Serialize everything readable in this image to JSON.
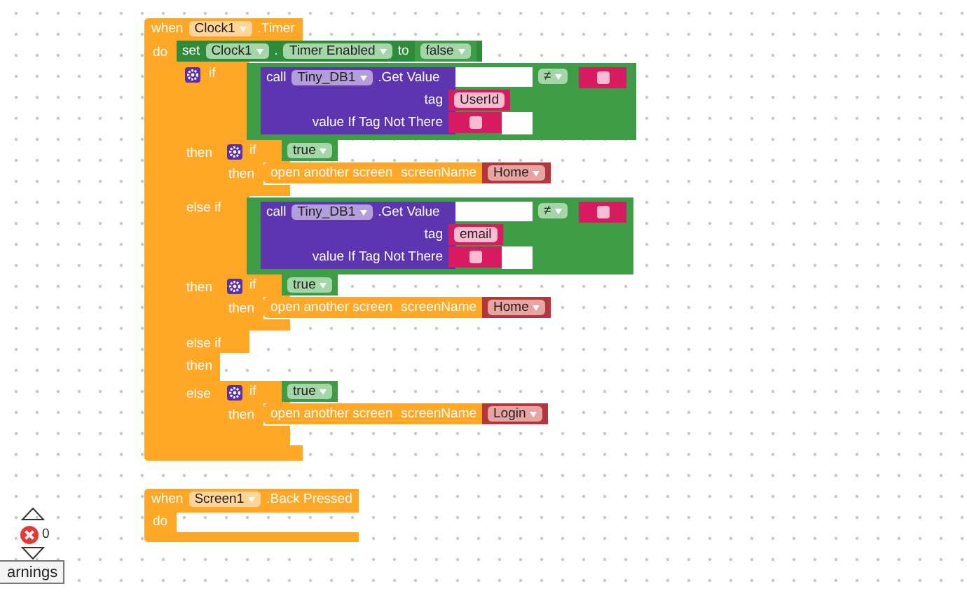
{
  "workspace": {
    "timer_event": {
      "when": "when",
      "component": "Clock1",
      "event": ".Timer",
      "do": "do"
    },
    "set_block": {
      "set": "set",
      "component": "Clock1",
      "dot": ".",
      "property": "Timer Enabled",
      "to": "to",
      "value": "false"
    },
    "if_block": {
      "arms": [
        {
          "label": "if",
          "kind": "test",
          "condition": {
            "call": "call",
            "component": "Tiny_DB1",
            "method": ".Get Value",
            "tag_label": "tag",
            "tag": "UserId",
            "default_label": "value If Tag Not There",
            "operator": "≠"
          }
        },
        {
          "label": "then",
          "kind": "do",
          "statement": {
            "if": "if",
            "test": "true",
            "then": "then",
            "action": "open another screen",
            "param": "screenName",
            "screen": "Home"
          }
        },
        {
          "label": "else if",
          "kind": "test",
          "condition": {
            "call": "call",
            "component": "Tiny_DB1",
            "method": ".Get Value",
            "tag_label": "tag",
            "tag": "email",
            "default_label": "value If Tag Not There",
            "operator": "≠"
          }
        },
        {
          "label": "then",
          "kind": "do",
          "statement": {
            "if": "if",
            "test": "true",
            "then": "then",
            "action": "open another screen",
            "param": "screenName",
            "screen": "Home"
          }
        },
        {
          "label": "else if",
          "kind": "test"
        },
        {
          "label": "then",
          "kind": "do"
        },
        {
          "label": "else",
          "kind": "do",
          "statement": {
            "if": "if",
            "test": "true",
            "then": "then",
            "action": "open another screen",
            "param": "screenName",
            "screen": "Login"
          }
        }
      ]
    },
    "back_event": {
      "when": "when",
      "component": "Screen1",
      "event": ".Back Pressed",
      "do": "do"
    },
    "warnings": {
      "error_count": "0",
      "button": "arnings"
    }
  }
}
